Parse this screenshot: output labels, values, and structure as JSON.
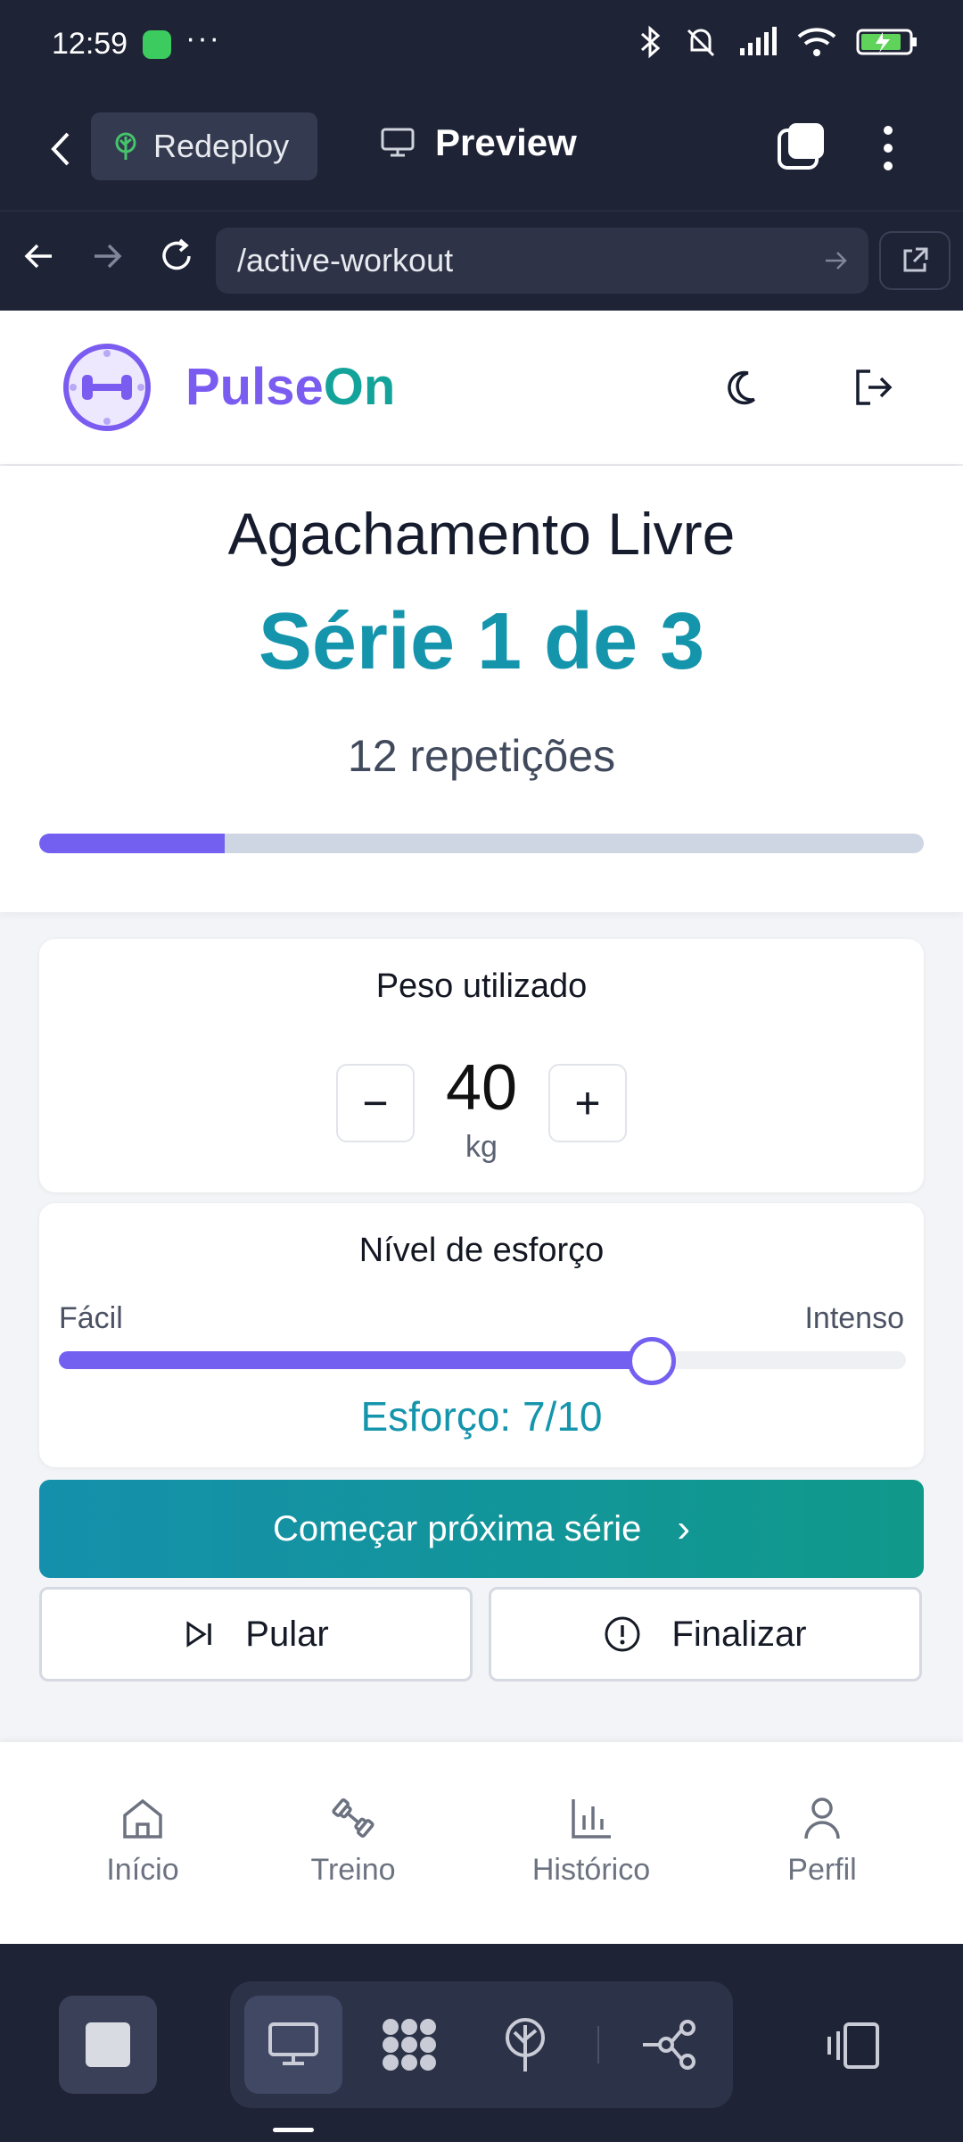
{
  "status_bar": {
    "time": "12:59",
    "overflow": "···"
  },
  "browser": {
    "redeploy_label": "Redeploy",
    "preview_label": "Preview",
    "url": "/active-workout"
  },
  "app": {
    "brand_part1": "Pulse",
    "brand_part2": "On",
    "exercise": {
      "name": "Agachamento Livre",
      "series_text": "Série 1 de 3",
      "reps_text": "12 repetições",
      "series_progress": 0.21
    },
    "weight": {
      "title": "Peso utilizado",
      "value": "40",
      "unit": "kg",
      "minus": "−",
      "plus": "+"
    },
    "effort": {
      "title": "Nível de esforço",
      "min_label": "Fácil",
      "max_label": "Intenso",
      "value": 7,
      "max": 10,
      "value_text": "Esforço: 7/10"
    },
    "actions": {
      "next_label": "Começar próxima série",
      "next_chevron": "›",
      "skip_label": "Pular",
      "finish_label": "Finalizar"
    },
    "nav": [
      {
        "label": "Início",
        "icon": "home-icon"
      },
      {
        "label": "Treino",
        "icon": "dumbbell-icon"
      },
      {
        "label": "Histórico",
        "icon": "bar-chart-icon"
      },
      {
        "label": "Perfil",
        "icon": "user-icon"
      }
    ]
  },
  "colors": {
    "brand_purple": "#7b5cf0",
    "brand_teal": "#14a39a",
    "accent_cyan": "#1595ac",
    "dark_chrome": "#1f2336"
  }
}
